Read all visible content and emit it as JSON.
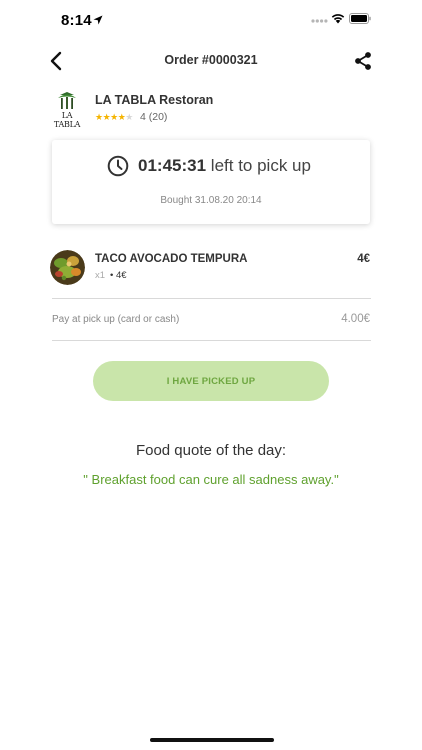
{
  "status_bar": {
    "time": "8:14",
    "icons": [
      "location-arrow-icon",
      "cellular-signal-icon",
      "wifi-icon",
      "battery-icon"
    ]
  },
  "nav": {
    "title": "Order #0000321",
    "back_icon": "chevron-left-icon",
    "share_icon": "share-icon"
  },
  "restaurant": {
    "logo_text": "LA TABLA",
    "name": "LA TABLA Restoran",
    "stars_filled": "★★★★",
    "stars_empty": "★",
    "rating_text": "4 (20)",
    "rating_value": 4,
    "rating_max": 5
  },
  "timer": {
    "icon": "clock-icon",
    "time_left": "01:45:31",
    "suffix": "left to pick up",
    "bought": "Bought 31.08.20 20:14"
  },
  "order_item": {
    "name": "TACO AVOCADO TEMPURA",
    "quantity": "x1",
    "separator": "•",
    "unit_price": "4€",
    "total": "4€"
  },
  "payment": {
    "label": "Pay at pick up (card or cash)",
    "amount": "4.00€"
  },
  "actions": {
    "picked_up_label": "I HAVE PICKED UP"
  },
  "quote": {
    "title": "Food quote of the day:",
    "text": "\" Breakfast food can cure all sadness away.\""
  },
  "colors": {
    "accent_green": "#5fa12e",
    "button_bg": "#c9e5aa",
    "button_text": "#6ea640",
    "star": "#f5b400"
  }
}
